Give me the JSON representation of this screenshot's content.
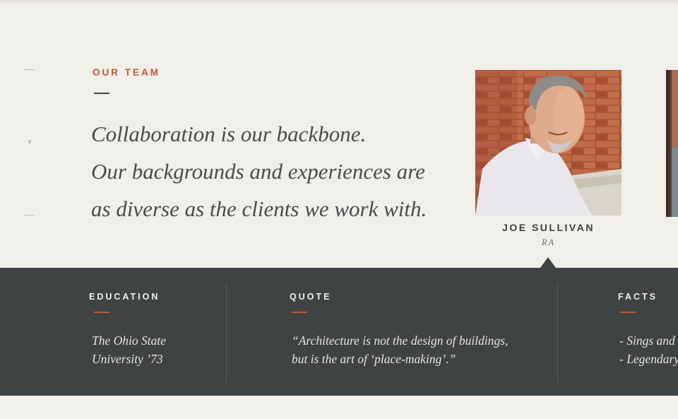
{
  "section": {
    "eyebrow": "OUR TEAM",
    "headline": [
      "Collaboration is our backbone.",
      "Our backgrounds and experiences are",
      "as diverse as the clients we work with."
    ]
  },
  "member": {
    "name": "JOE SULLIVAN",
    "title": "RA",
    "photo_alt": "Portrait of Joe Sullivan"
  },
  "details": {
    "education": {
      "heading": "EDUCATION",
      "lines": [
        "The Ohio State",
        "University ’73"
      ]
    },
    "quote": {
      "heading": "QUOTE",
      "lines": [
        "“Architecture is not the design of buildings,",
        "but is the art of ‘place-making’.”"
      ]
    },
    "facts": {
      "heading": "FACTS",
      "lines": [
        "- Sings and",
        "- Legendary"
      ]
    }
  },
  "colors": {
    "accent": "#c2583a",
    "panel": "#3f4344",
    "background": "#f1efea"
  }
}
